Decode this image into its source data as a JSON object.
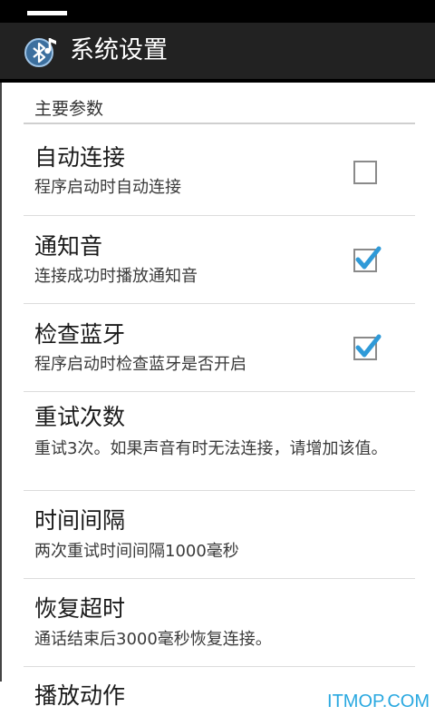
{
  "app": {
    "title": "系统设置"
  },
  "category": {
    "label": "主要参数"
  },
  "preferences": [
    {
      "title": "自动连接",
      "summary": "程序启动时自动连接",
      "checked": false
    },
    {
      "title": "通知音",
      "summary": "连接成功时播放通知音",
      "checked": true
    },
    {
      "title": "检查蓝牙",
      "summary": "程序启动时检查蓝牙是否开启",
      "checked": true
    },
    {
      "title": "重试次数",
      "summary": "重试3次。如果声音有时无法连接，请增加该值。"
    },
    {
      "title": "时间间隔",
      "summary": "两次重试时间间隔1000毫秒"
    },
    {
      "title": "恢复超时",
      "summary": "通话结束后3000毫秒恢复连接。"
    },
    {
      "title": "播放动作"
    }
  ],
  "watermark": "ITMOP.COM",
  "colors": {
    "check_accent": "#2f9ad8",
    "action_bar": "#222222",
    "status_bar": "#000000"
  },
  "icons": {
    "app": "bluetooth-music-icon"
  }
}
